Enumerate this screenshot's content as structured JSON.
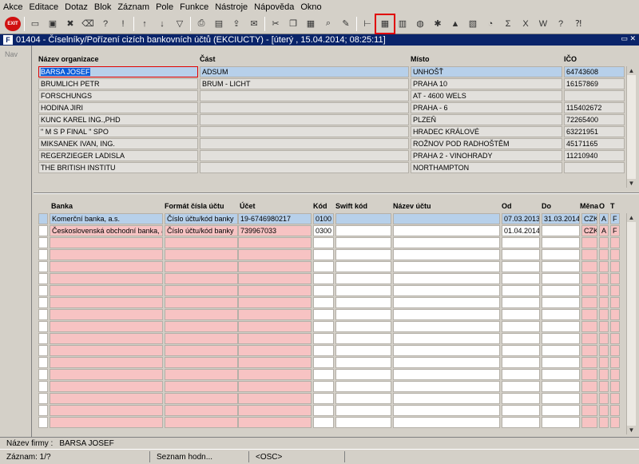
{
  "menu": [
    "Akce",
    "Editace",
    "Dotaz",
    "Blok",
    "Záznam",
    "Pole",
    "Funkce",
    "Nástroje",
    "Nápověda",
    "Okno"
  ],
  "toolbar": {
    "exit_label": "EXIT",
    "icons": [
      "new-icon",
      "save-icon",
      "delete-icon",
      "clear-icon",
      "enter-query-icon",
      "execute-query-icon",
      "sort-asc-icon",
      "sort-desc-icon",
      "filter-icon",
      "print-icon",
      "print-preview-icon",
      "export-icon",
      "mail-icon",
      "cut-icon",
      "copy-icon",
      "paste-icon",
      "find-icon",
      "edit-icon",
      "tree-icon",
      "calendar-icon",
      "form-icon",
      "world-icon",
      "settings-icon",
      "warning-icon",
      "report-icon",
      "chart-icon",
      "sum-icon",
      "excel-icon",
      "word-icon",
      "help-icon",
      "context-help-icon"
    ]
  },
  "window": {
    "title": "01404 - Číselníky/Pořízení cizích bankovních účtů (EKCIUCTY) - [úterý  , 15.04.2014; 08:25:11]",
    "nav_label": "Nav"
  },
  "org_table": {
    "headers": [
      "Název organizace",
      "Část",
      "Místo",
      "IČO"
    ],
    "rows": [
      [
        "BARSA JOSEF",
        "ADSUM",
        "UNHOŠŤ",
        "64743608"
      ],
      [
        "BRUMLICH PETR",
        "BRUM - LICHT",
        "PRAHA  10",
        "16157869"
      ],
      [
        "FORSCHUNGS",
        "",
        "AT - 4600 WELS",
        ""
      ],
      [
        "HODINA JIRI",
        "",
        "PRAHA - 6",
        "115402672"
      ],
      [
        "KUNC KAREL ING.,PHD",
        "",
        "PLZEŇ",
        "72265400"
      ],
      [
        "\" M S P  FINAL \" SPO",
        "",
        "HRADEC KRÁLOVÉ",
        "63221951"
      ],
      [
        "MIKSANEK IVAN, ING.",
        "",
        "ROŽNOV POD RADHOŠTĚM",
        "45171165"
      ],
      [
        "REGERZIEGER LADISLA",
        "",
        "PRAHA 2 - VINOHRADY",
        "11210940"
      ],
      [
        "THE BRITISH INSTITU",
        "",
        "NORTHAMPTON",
        ""
      ]
    ]
  },
  "bank_table": {
    "headers": [
      "Banka",
      "Formát čísla účtu",
      "Účet",
      "Kód",
      "Swift kód",
      "Název účtu",
      "Od",
      "Do",
      "Měna",
      "O",
      "T"
    ],
    "rows": [
      [
        "Komerční banka, a.s.",
        "Číslo účtu/kód banky",
        "19-6746980217",
        "0100",
        "",
        "",
        "07.03.2013",
        "31.03.2014",
        "CZK",
        "A",
        "F"
      ],
      [
        "Československá obchodní banka, a.",
        "Číslo účtu/kód banky",
        "739967033",
        "0300",
        "",
        "",
        "01.04.2014",
        "",
        "CZK",
        "A",
        "F"
      ]
    ]
  },
  "status": {
    "firm_label": "Název firmy :",
    "firm_value": "BARSA JOSEF",
    "record": "Záznam: 1/?",
    "list": "Seznam hodn...",
    "osc": "<OSC>"
  }
}
